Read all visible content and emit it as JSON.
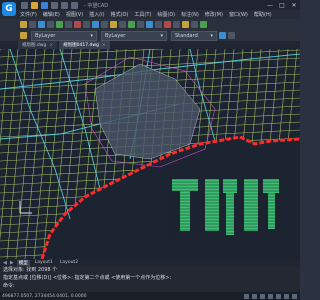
{
  "app": {
    "logo_letter": "G",
    "title": "- 中望CAD"
  },
  "window_controls": {
    "minimize": "—",
    "maximize": "□",
    "close": "✕"
  },
  "menus": [
    "文件(F)",
    "编辑(E)",
    "视图(V)",
    "插入(I)",
    "格式(O)",
    "工具(T)",
    "绘图(D)",
    "标注(N)",
    "修改(M)",
    "窗口(W)",
    "帮助(H)"
  ],
  "toolbar2": {
    "layer_dropdown": "ByLayer",
    "linetype_dropdown": "ByLayer",
    "style_dropdown": "Standard"
  },
  "doc_tabs": [
    {
      "label": "规划图.dwg",
      "active": false
    },
    {
      "label": "规划图0417.dwg",
      "active": true
    }
  ],
  "layout_tabs": [
    "模型",
    "Layout1",
    "Layout2"
  ],
  "command_lines": [
    "选择对象: 找到 2098 个",
    "指定基点或 [位移(D)] <位移>:  指定第二个点或 <使用第一个点作为位移>:",
    "命令:"
  ],
  "status": {
    "coordinates": "496877.0507, 2734454.0401, 0.0000"
  },
  "colors": {
    "canvas_bg": "#1c2331",
    "grid_green": "#b7d86b",
    "shore_red": "#ff2a2a",
    "road_cyan": "#5bd6e6",
    "accent": "#1e88e5"
  }
}
